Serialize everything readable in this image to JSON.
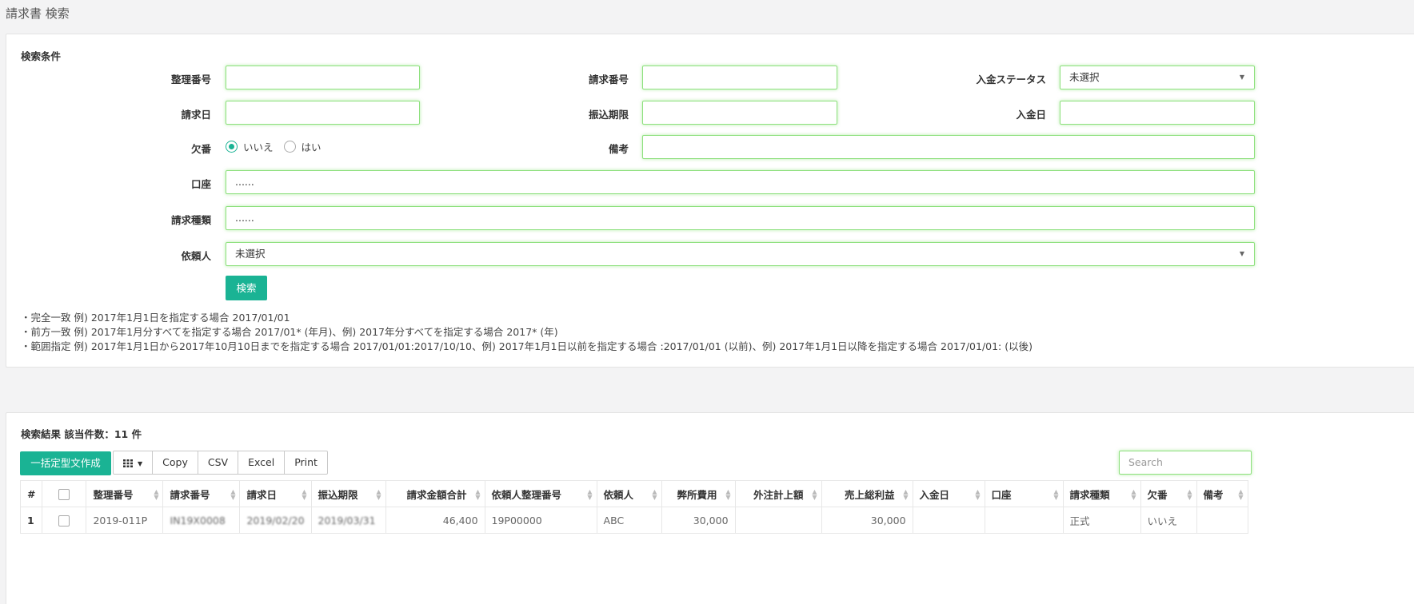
{
  "page": {
    "title": "請求書 検索"
  },
  "search": {
    "heading": "検索条件",
    "fields": {
      "seiri_label": "整理番号",
      "seiri_value": "",
      "seikyu_bango_label": "請求番号",
      "seikyu_bango_value": "",
      "nyukin_status_label": "入金ステータス",
      "nyukin_status_value": "未選択",
      "seikyu_bi_label": "請求日",
      "seikyu_bi_value": "",
      "furikomi_label": "振込期限",
      "furikomi_value": "",
      "nyukin_bi_label": "入金日",
      "nyukin_bi_value": "",
      "ketsuban_label": "欠番",
      "ketsuban_no": "いいえ",
      "ketsuban_yes": "はい",
      "biko_label": "備考",
      "biko_value": "",
      "koza_label": "口座",
      "koza_value": "......",
      "seikyu_shurui_label": "請求種類",
      "seikyu_shurui_value": "......",
      "irainin_label": "依頼人",
      "irainin_value": "未選択"
    },
    "search_button": "検索",
    "hints": [
      "・完全一致 例) 2017年1月1日を指定する場合 2017/01/01",
      "・前方一致 例) 2017年1月分すべてを指定する場合 2017/01* (年月)、例) 2017年分すべてを指定する場合 2017* (年)",
      "・範囲指定 例) 2017年1月1日から2017年10月10日までを指定する場合 2017/01/01:2017/10/10、例) 2017年1月1日以前を指定する場合 :2017/01/01 (以前)、例) 2017年1月1日以降を指定する場合 2017/01/01: (以後)"
    ]
  },
  "results": {
    "heading": "検索結果 該当件数：11 件",
    "bulk_button": "一括定型文作成",
    "toolbar": {
      "copy": "Copy",
      "csv": "CSV",
      "excel": "Excel",
      "print": "Print"
    },
    "search_placeholder": "Search",
    "columns": [
      "#",
      "",
      "整理番号",
      "請求番号",
      "請求日",
      "振込期限",
      "請求金額合計",
      "依頼人整理番号",
      "依頼人",
      "弊所費用",
      "外注計上額",
      "売上総利益",
      "入金日",
      "口座",
      "請求種類",
      "欠番",
      "備考"
    ],
    "rows": [
      {
        "no": "1",
        "seiri": "2019-011P",
        "seikyu_bango": "IN19X0008",
        "seikyu_bi": "2019/02/20",
        "furikomi": "2019/03/31",
        "kingaku": "46,400",
        "irainin_seiri": "19P00000",
        "irainin": "ABC",
        "heisho_hiyo": "30,000",
        "gaichu": "",
        "uriage": "30,000",
        "nyukin_bi": "",
        "koza": "",
        "shurui": "正式",
        "ketsuban": "いいえ",
        "biko": ""
      }
    ]
  }
}
